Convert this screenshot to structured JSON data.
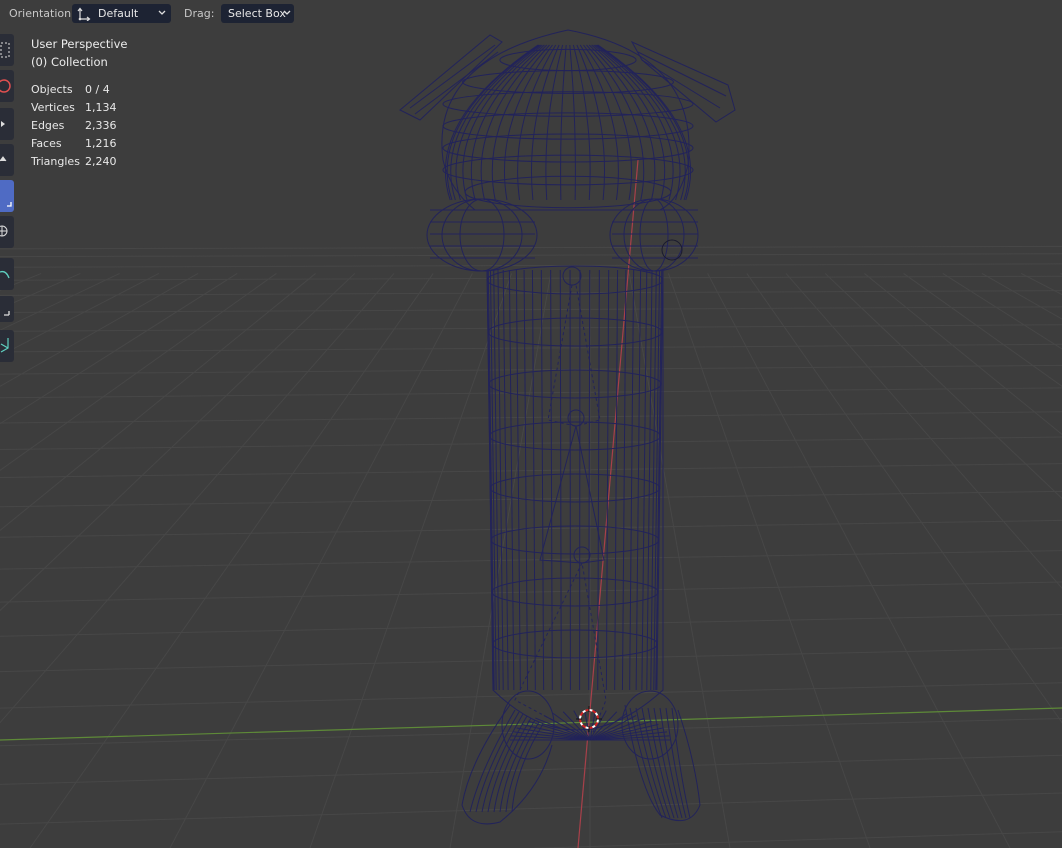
{
  "header": {
    "orientation_label": "Orientation:",
    "orientation_value": "Default",
    "drag_label": "Drag:",
    "drag_value": "Select Box"
  },
  "overlay": {
    "view_name": "User Perspective",
    "collection": "(0) Collection"
  },
  "stats": [
    {
      "name": "Objects",
      "value": "0 / 4"
    },
    {
      "name": "Vertices",
      "value": "1,134"
    },
    {
      "name": "Edges",
      "value": "2,336"
    },
    {
      "name": "Faces",
      "value": "1,216"
    },
    {
      "name": "Triangles",
      "value": "2,240"
    }
  ],
  "toolbar": {
    "tools": [
      {
        "icon": "select-box-icon"
      },
      {
        "icon": "cursor-icon"
      },
      {
        "icon": "move-icon"
      },
      {
        "icon": "rotate-icon"
      },
      {
        "icon": "scale-icon",
        "active": true
      },
      {
        "icon": "transform-icon"
      },
      {
        "icon": "annotate-icon"
      },
      {
        "icon": "measure-icon"
      },
      {
        "icon": "add-cube-icon"
      }
    ]
  },
  "colors": {
    "background": "#3d3d3d",
    "grid": "#4a4a4a",
    "x_axis": "#b0404a",
    "y_axis": "#6b9a3a",
    "wireframe": "#22235a",
    "header_widget": "#1d2333",
    "active_tool": "#4f6bc4"
  }
}
